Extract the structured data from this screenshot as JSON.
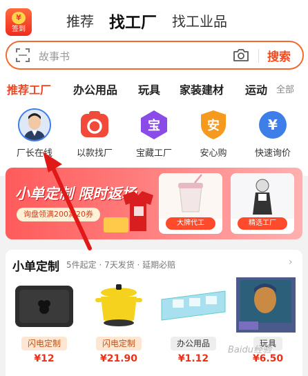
{
  "signin": {
    "label": "签到"
  },
  "top_tabs": [
    {
      "label": "推荐",
      "active": false
    },
    {
      "label": "找工厂",
      "active": true
    },
    {
      "label": "找工业品",
      "active": false
    }
  ],
  "search": {
    "placeholder": "故事书",
    "button_label": "搜索"
  },
  "categories": [
    {
      "label": "推荐工厂",
      "active": true
    },
    {
      "label": "办公用品",
      "active": false
    },
    {
      "label": "玩具",
      "active": false
    },
    {
      "label": "家装建材",
      "active": false
    },
    {
      "label": "运动",
      "active": false
    }
  ],
  "categories_all": "全部",
  "quick_links": [
    {
      "label": "厂长在线",
      "icon": "factory-manager-avatar"
    },
    {
      "label": "以款找厂",
      "icon": "camera-icon",
      "color": "#f24a3a"
    },
    {
      "label": "宝藏工厂",
      "icon": "treasure-icon",
      "glyph": "宝",
      "color": "#8a4be8"
    },
    {
      "label": "安心购",
      "icon": "shield-icon",
      "glyph": "安",
      "color": "#f59a1e"
    },
    {
      "label": "快速询价",
      "icon": "yen-icon",
      "glyph": "¥",
      "color": "#3d7ee8"
    }
  ],
  "banner": {
    "title": "小单定制 限时返场",
    "coupon": "询盘领满200减20券",
    "cards": [
      {
        "tag": "大牌代工"
      },
      {
        "tag": "精选工厂"
      }
    ]
  },
  "section": {
    "title": "小单定制",
    "subtitle": "5件起定 · 7天发货 · 延期必赔",
    "more": "›",
    "products": [
      {
        "badge": "闪电定制",
        "price": "¥12",
        "style": "hot"
      },
      {
        "badge": "闪电定制",
        "price": "¥21.90",
        "style": "hot"
      },
      {
        "badge": "办公用品",
        "price": "¥1.12",
        "style": "plain"
      },
      {
        "badge": "玩具",
        "price": "¥6.50",
        "style": "plain"
      }
    ]
  },
  "watermark": "Baidu经验",
  "colors": {
    "accent": "#f24a1e",
    "annotation_arrow": "#e01818"
  }
}
